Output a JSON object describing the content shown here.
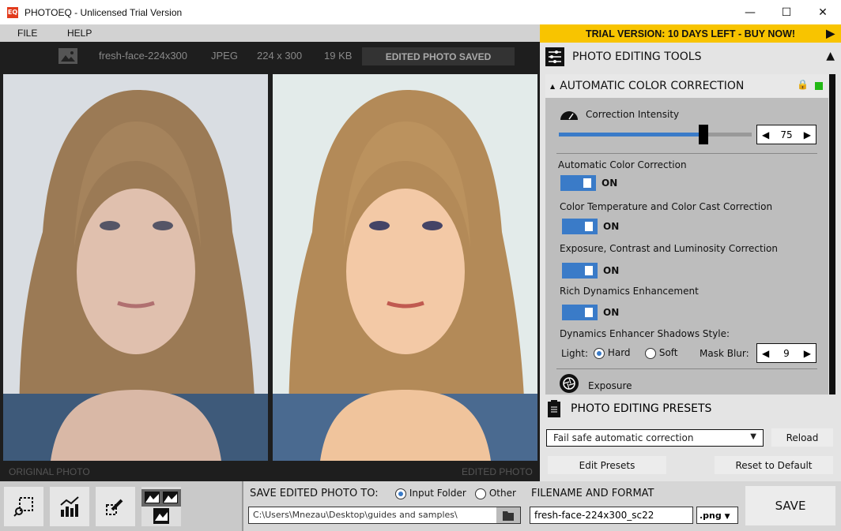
{
  "app": {
    "title": "PHOTOEQ - ",
    "subtitle": "Unlicensed Trial Version",
    "logo": "EQ"
  },
  "window": {
    "minimize": "—",
    "maximize": "☐",
    "close": "✕"
  },
  "menu": [
    {
      "label": "FILE"
    },
    {
      "label": "HELP"
    }
  ],
  "info": {
    "filename": "fresh-face-224x300",
    "format": "JPEG",
    "dimensions": "224 x 300",
    "size": "19 KB",
    "status": "EDITED PHOTO SAVED"
  },
  "photos": {
    "original_label": "ORIGINAL PHOTO",
    "edited_label": "EDITED PHOTO"
  },
  "trial": {
    "label": "TRIAL VERSION: 10 DAYS LEFT - BUY NOW!"
  },
  "tools": {
    "title": "PHOTO EDITING TOOLS",
    "section": {
      "title": "AUTOMATIC COLOR CORRECTION",
      "status_color": "#22b814",
      "intensity_label": "Correction Intensity",
      "intensity_value": "75",
      "intensity_percent": 75,
      "toggles": [
        {
          "label": "Automatic Color Correction",
          "state": "ON"
        },
        {
          "label": "Color Temperature and Color Cast Correction",
          "state": "ON"
        },
        {
          "label": "Exposure, Contrast and Luminosity Correction",
          "state": "ON"
        },
        {
          "label": "Rich Dynamics Enhancement",
          "state": "ON"
        }
      ],
      "shadows_label": "Dynamics Enhancer Shadows Style:",
      "light_label": "Light:",
      "hard": "Hard",
      "soft": "Soft",
      "light_selected": "Hard",
      "mask_blur_label": "Mask Blur:",
      "mask_blur_value": "9",
      "next_section": "Exposure"
    }
  },
  "presets": {
    "title": "PHOTO EDITING PRESETS",
    "selected": "Fail safe automatic correction",
    "reload": "Reload",
    "edit": "Edit Presets",
    "reset": "Reset to Default"
  },
  "save": {
    "label": "SAVE EDITED PHOTO TO:",
    "input_folder": "Input Folder",
    "other": "Other",
    "selected": "Input Folder",
    "path": "C:\\Users\\Mnezau\\Desktop\\guides and samples\\",
    "filename_label": "FILENAME AND FORMAT",
    "filename": "fresh-face-224x300_sc22",
    "format": ".png",
    "button": "SAVE"
  },
  "colors": {
    "accent": "#3a7bc8",
    "trial": "#f8c400"
  }
}
